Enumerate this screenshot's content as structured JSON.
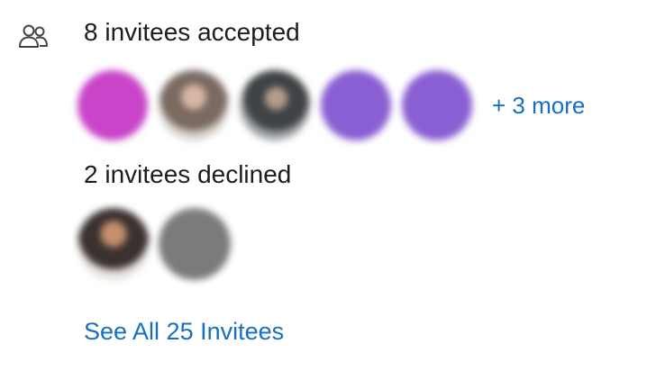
{
  "accepted": {
    "heading": "8 invitees accepted",
    "avatars": [
      {
        "kind": "initials",
        "color": "#c944c9",
        "initials": ""
      },
      {
        "kind": "photo",
        "color": "#7a6a62"
      },
      {
        "kind": "photo",
        "color": "#5b5e5f"
      },
      {
        "kind": "initials",
        "color": "#8a5fd3",
        "initials": ""
      },
      {
        "kind": "initials",
        "color": "#8a5fd3",
        "initials": ""
      }
    ],
    "more_label": "+ 3 more"
  },
  "declined": {
    "heading": "2 invitees declined",
    "avatars": [
      {
        "kind": "photo",
        "color": "#6b5245"
      },
      {
        "kind": "initials",
        "color": "#7b7b7b",
        "initials": ""
      }
    ]
  },
  "see_all_label": "See All 25 Invitees",
  "icons": {
    "people": "people-icon"
  },
  "colors": {
    "link": "#1570c4",
    "text": "#1d1d1f"
  }
}
